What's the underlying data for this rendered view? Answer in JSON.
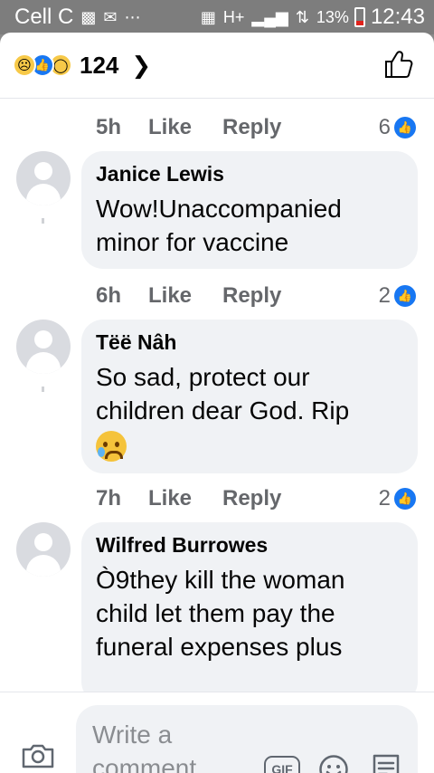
{
  "status_bar": {
    "carrier": "Cell C",
    "network": "H+",
    "battery_percent": "13%",
    "time": "12:43"
  },
  "header": {
    "reaction_count": "124",
    "reactions": [
      "sad-reaction",
      "like-reaction",
      "wow-reaction"
    ]
  },
  "comments": [
    {
      "meta": {
        "time": "5h",
        "like": "Like",
        "reply": "Reply",
        "likes": "6"
      }
    },
    {
      "name": "Janice Lewis",
      "text": "Wow!Unaccompanied minor for vaccine",
      "meta": {
        "time": "6h",
        "like": "Like",
        "reply": "Reply",
        "likes": "2"
      }
    },
    {
      "name": "Tëë Nâh",
      "text": "So sad, protect our children dear God. Rip",
      "meta": {
        "time": "7h",
        "like": "Like",
        "reply": "Reply",
        "likes": "2"
      }
    },
    {
      "name": "Wilfred Burrowes",
      "text": "Ò9they kill the woman child let them pay the funeral expenses plus"
    }
  ],
  "composer": {
    "placeholder": "Write a comment…",
    "gif_label": "GIF"
  },
  "colors": {
    "accent": "#1877f2",
    "bubble": "#f0f2f5",
    "meta_text": "#65676b"
  }
}
